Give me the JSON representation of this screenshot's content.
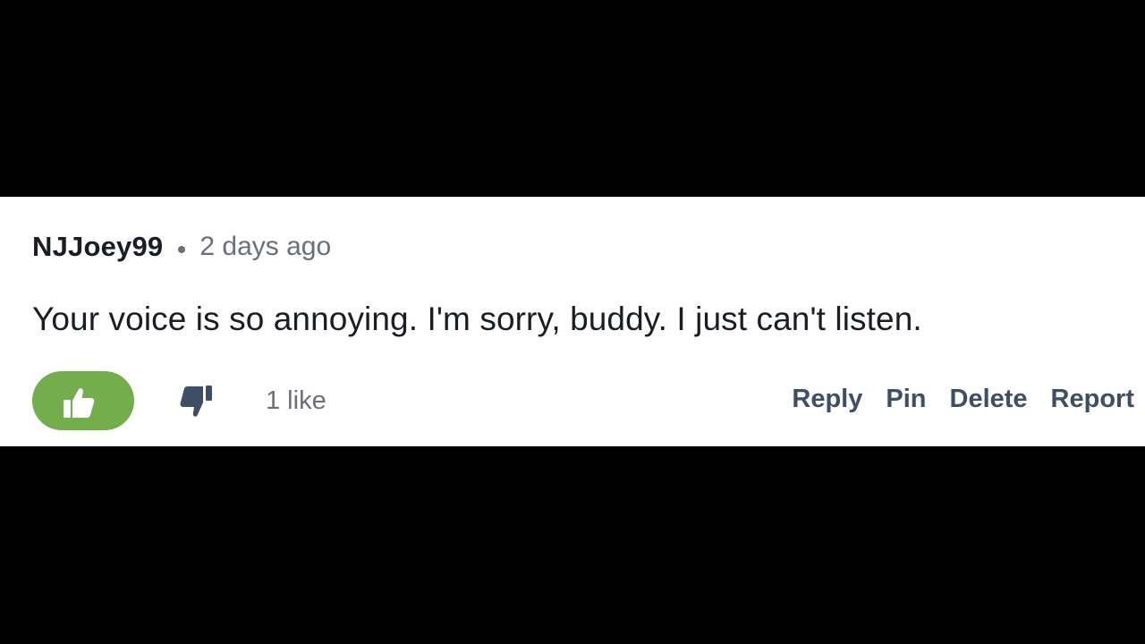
{
  "comment": {
    "username": "NJJoey99",
    "timestamp": "2 days ago",
    "body": "Your voice is so annoying. I'm sorry, buddy. I just can't listen.",
    "like_count_text": "1 like"
  },
  "actions": {
    "like_icon": "thumbs-up-icon",
    "dislike_icon": "thumbs-down-icon",
    "reply_label": "Reply",
    "pin_label": "Pin",
    "delete_label": "Delete",
    "report_label": "Report"
  },
  "colors": {
    "background": "#000000",
    "card": "#ffffff",
    "like_active": "#73ad4c",
    "username": "#1a1d24",
    "muted": "#6b6f78",
    "action_link": "#3e4e66"
  }
}
